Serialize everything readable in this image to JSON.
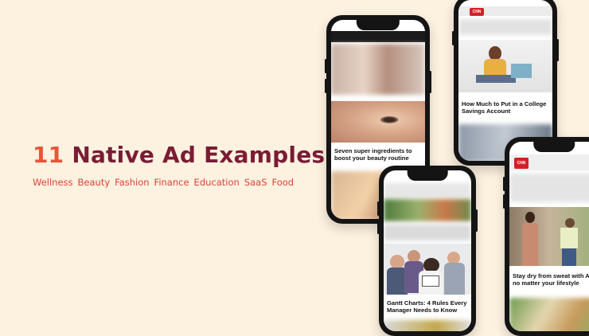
{
  "headline": {
    "number": "11",
    "rest": "Native Ad Examples"
  },
  "categories": [
    "Wellness",
    "Beauty",
    "Fashion",
    "Finance",
    "Education",
    "SaaS",
    "Food"
  ],
  "phones": {
    "beauty": {
      "caption": "Seven super ingredients to boost your beauty routine"
    },
    "finance": {
      "caption": "How Much to Put in a College Savings Account",
      "logo": "CNN"
    },
    "saas": {
      "caption": "Gantt Charts: 4 Rules Every Manager Needs to Know"
    },
    "wellness": {
      "caption": "Stay dry from sweat with AI no matter your lifestyle",
      "logo": "CNN"
    }
  },
  "colors": {
    "background": "#fdf1e0",
    "headline_number": "#e8553b",
    "headline_text": "#7a1c35",
    "categories": "#d9443a",
    "phone_body": "#141414"
  }
}
